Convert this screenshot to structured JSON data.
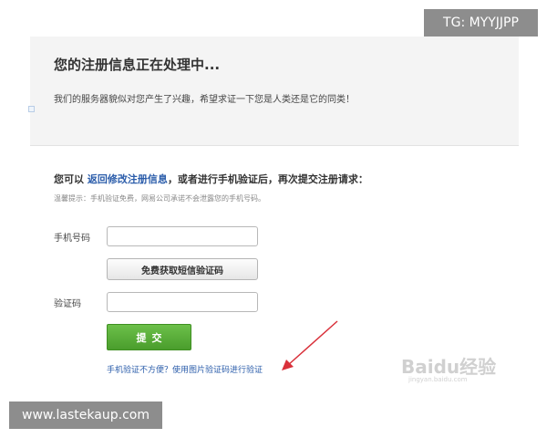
{
  "header": {
    "title": "您的注册信息正在处理中...",
    "description": "我们的服务器貌似对您产生了兴趣，希望求证一下您是人类还是它的同类！"
  },
  "form": {
    "lead_prefix": "您可以",
    "lead_link": "返回修改注册信息",
    "lead_suffix": "，或者进行手机验证后，再次提交注册请求：",
    "hint": "温馨提示：手机验证免费，网易公司承诺不会泄露您的手机号码。",
    "phone_label": "手机号码",
    "phone_value": "",
    "sms_button_label": "免费获取短信验证码",
    "code_label": "验证码",
    "code_value": "",
    "submit_label": "提交",
    "alt_link": "手机验证不方便？使用图片验证码进行验证"
  },
  "annotation": {
    "arrow_color": "#d9303a"
  },
  "watermarks": {
    "tg": "TG: MYYJJPP",
    "site": "www.lastekaup.com",
    "baidu": "Baidu经验",
    "baidu_sub": "jingyan.baidu.com"
  },
  "colors": {
    "link": "#2a5caa",
    "submit_green": "#5aae3a",
    "header_bg": "#f4f4f4"
  }
}
